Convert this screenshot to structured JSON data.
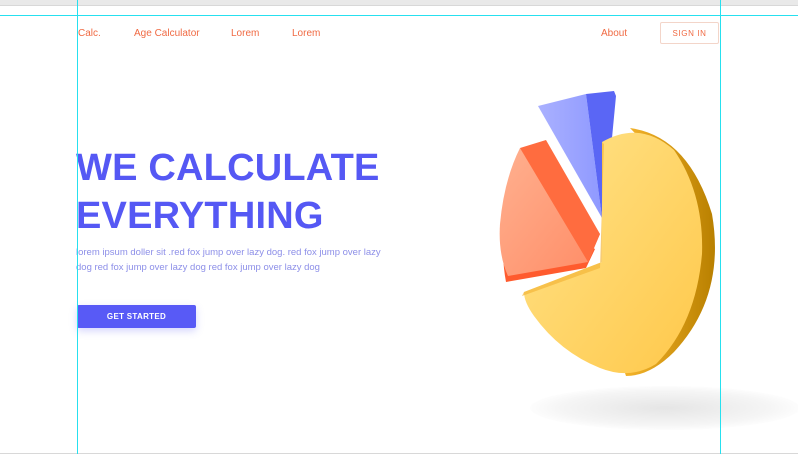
{
  "nav": {
    "logo": "Calc.",
    "links": [
      "Age Calculator",
      "Lorem",
      "Lorem"
    ],
    "about": "About",
    "signin": "SIGN IN"
  },
  "hero": {
    "title_line1": "WE CALCULATE",
    "title_line2": "EVERYTHING",
    "description": "lorem ipsum doller sit .red fox jump over lazy dog. red fox jump over lazy dog red fox jump over lazy dog red fox jump over lazy dog",
    "cta": "GET STARTED"
  },
  "illustration": {
    "name": "3d-pie-chart-icon",
    "colors": {
      "yellow": "#ffd166",
      "orange": "#ff8a6a",
      "blue": "#5a66f5"
    }
  },
  "guides": {
    "color": "#26e0ef"
  }
}
